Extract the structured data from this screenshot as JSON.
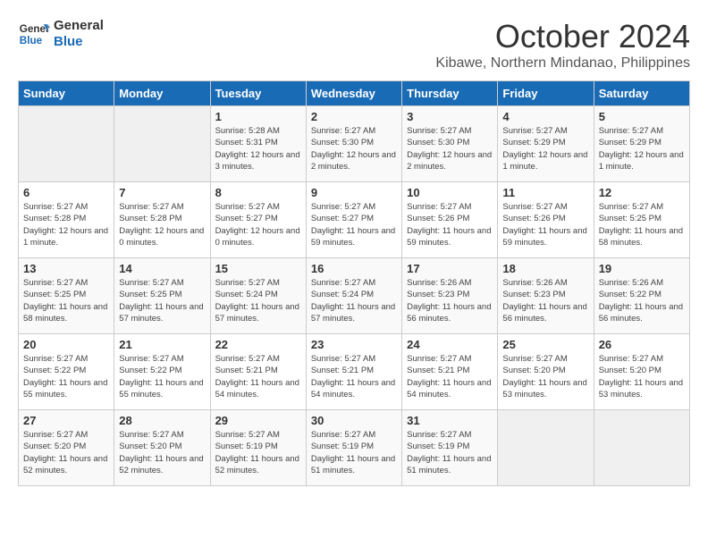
{
  "logo": {
    "line1": "General",
    "line2": "Blue"
  },
  "title": "October 2024",
  "location": "Kibawe, Northern Mindanao, Philippines",
  "days_of_week": [
    "Sunday",
    "Monday",
    "Tuesday",
    "Wednesday",
    "Thursday",
    "Friday",
    "Saturday"
  ],
  "weeks": [
    [
      {
        "day": "",
        "info": ""
      },
      {
        "day": "",
        "info": ""
      },
      {
        "day": "1",
        "info": "Sunrise: 5:28 AM\nSunset: 5:31 PM\nDaylight: 12 hours and 3 minutes."
      },
      {
        "day": "2",
        "info": "Sunrise: 5:27 AM\nSunset: 5:30 PM\nDaylight: 12 hours and 2 minutes."
      },
      {
        "day": "3",
        "info": "Sunrise: 5:27 AM\nSunset: 5:30 PM\nDaylight: 12 hours and 2 minutes."
      },
      {
        "day": "4",
        "info": "Sunrise: 5:27 AM\nSunset: 5:29 PM\nDaylight: 12 hours and 1 minute."
      },
      {
        "day": "5",
        "info": "Sunrise: 5:27 AM\nSunset: 5:29 PM\nDaylight: 12 hours and 1 minute."
      }
    ],
    [
      {
        "day": "6",
        "info": "Sunrise: 5:27 AM\nSunset: 5:28 PM\nDaylight: 12 hours and 1 minute."
      },
      {
        "day": "7",
        "info": "Sunrise: 5:27 AM\nSunset: 5:28 PM\nDaylight: 12 hours and 0 minutes."
      },
      {
        "day": "8",
        "info": "Sunrise: 5:27 AM\nSunset: 5:27 PM\nDaylight: 12 hours and 0 minutes."
      },
      {
        "day": "9",
        "info": "Sunrise: 5:27 AM\nSunset: 5:27 PM\nDaylight: 11 hours and 59 minutes."
      },
      {
        "day": "10",
        "info": "Sunrise: 5:27 AM\nSunset: 5:26 PM\nDaylight: 11 hours and 59 minutes."
      },
      {
        "day": "11",
        "info": "Sunrise: 5:27 AM\nSunset: 5:26 PM\nDaylight: 11 hours and 59 minutes."
      },
      {
        "day": "12",
        "info": "Sunrise: 5:27 AM\nSunset: 5:25 PM\nDaylight: 11 hours and 58 minutes."
      }
    ],
    [
      {
        "day": "13",
        "info": "Sunrise: 5:27 AM\nSunset: 5:25 PM\nDaylight: 11 hours and 58 minutes."
      },
      {
        "day": "14",
        "info": "Sunrise: 5:27 AM\nSunset: 5:25 PM\nDaylight: 11 hours and 57 minutes."
      },
      {
        "day": "15",
        "info": "Sunrise: 5:27 AM\nSunset: 5:24 PM\nDaylight: 11 hours and 57 minutes."
      },
      {
        "day": "16",
        "info": "Sunrise: 5:27 AM\nSunset: 5:24 PM\nDaylight: 11 hours and 57 minutes."
      },
      {
        "day": "17",
        "info": "Sunrise: 5:26 AM\nSunset: 5:23 PM\nDaylight: 11 hours and 56 minutes."
      },
      {
        "day": "18",
        "info": "Sunrise: 5:26 AM\nSunset: 5:23 PM\nDaylight: 11 hours and 56 minutes."
      },
      {
        "day": "19",
        "info": "Sunrise: 5:26 AM\nSunset: 5:22 PM\nDaylight: 11 hours and 56 minutes."
      }
    ],
    [
      {
        "day": "20",
        "info": "Sunrise: 5:27 AM\nSunset: 5:22 PM\nDaylight: 11 hours and 55 minutes."
      },
      {
        "day": "21",
        "info": "Sunrise: 5:27 AM\nSunset: 5:22 PM\nDaylight: 11 hours and 55 minutes."
      },
      {
        "day": "22",
        "info": "Sunrise: 5:27 AM\nSunset: 5:21 PM\nDaylight: 11 hours and 54 minutes."
      },
      {
        "day": "23",
        "info": "Sunrise: 5:27 AM\nSunset: 5:21 PM\nDaylight: 11 hours and 54 minutes."
      },
      {
        "day": "24",
        "info": "Sunrise: 5:27 AM\nSunset: 5:21 PM\nDaylight: 11 hours and 54 minutes."
      },
      {
        "day": "25",
        "info": "Sunrise: 5:27 AM\nSunset: 5:20 PM\nDaylight: 11 hours and 53 minutes."
      },
      {
        "day": "26",
        "info": "Sunrise: 5:27 AM\nSunset: 5:20 PM\nDaylight: 11 hours and 53 minutes."
      }
    ],
    [
      {
        "day": "27",
        "info": "Sunrise: 5:27 AM\nSunset: 5:20 PM\nDaylight: 11 hours and 52 minutes."
      },
      {
        "day": "28",
        "info": "Sunrise: 5:27 AM\nSunset: 5:20 PM\nDaylight: 11 hours and 52 minutes."
      },
      {
        "day": "29",
        "info": "Sunrise: 5:27 AM\nSunset: 5:19 PM\nDaylight: 11 hours and 52 minutes."
      },
      {
        "day": "30",
        "info": "Sunrise: 5:27 AM\nSunset: 5:19 PM\nDaylight: 11 hours and 51 minutes."
      },
      {
        "day": "31",
        "info": "Sunrise: 5:27 AM\nSunset: 5:19 PM\nDaylight: 11 hours and 51 minutes."
      },
      {
        "day": "",
        "info": ""
      },
      {
        "day": "",
        "info": ""
      }
    ]
  ]
}
